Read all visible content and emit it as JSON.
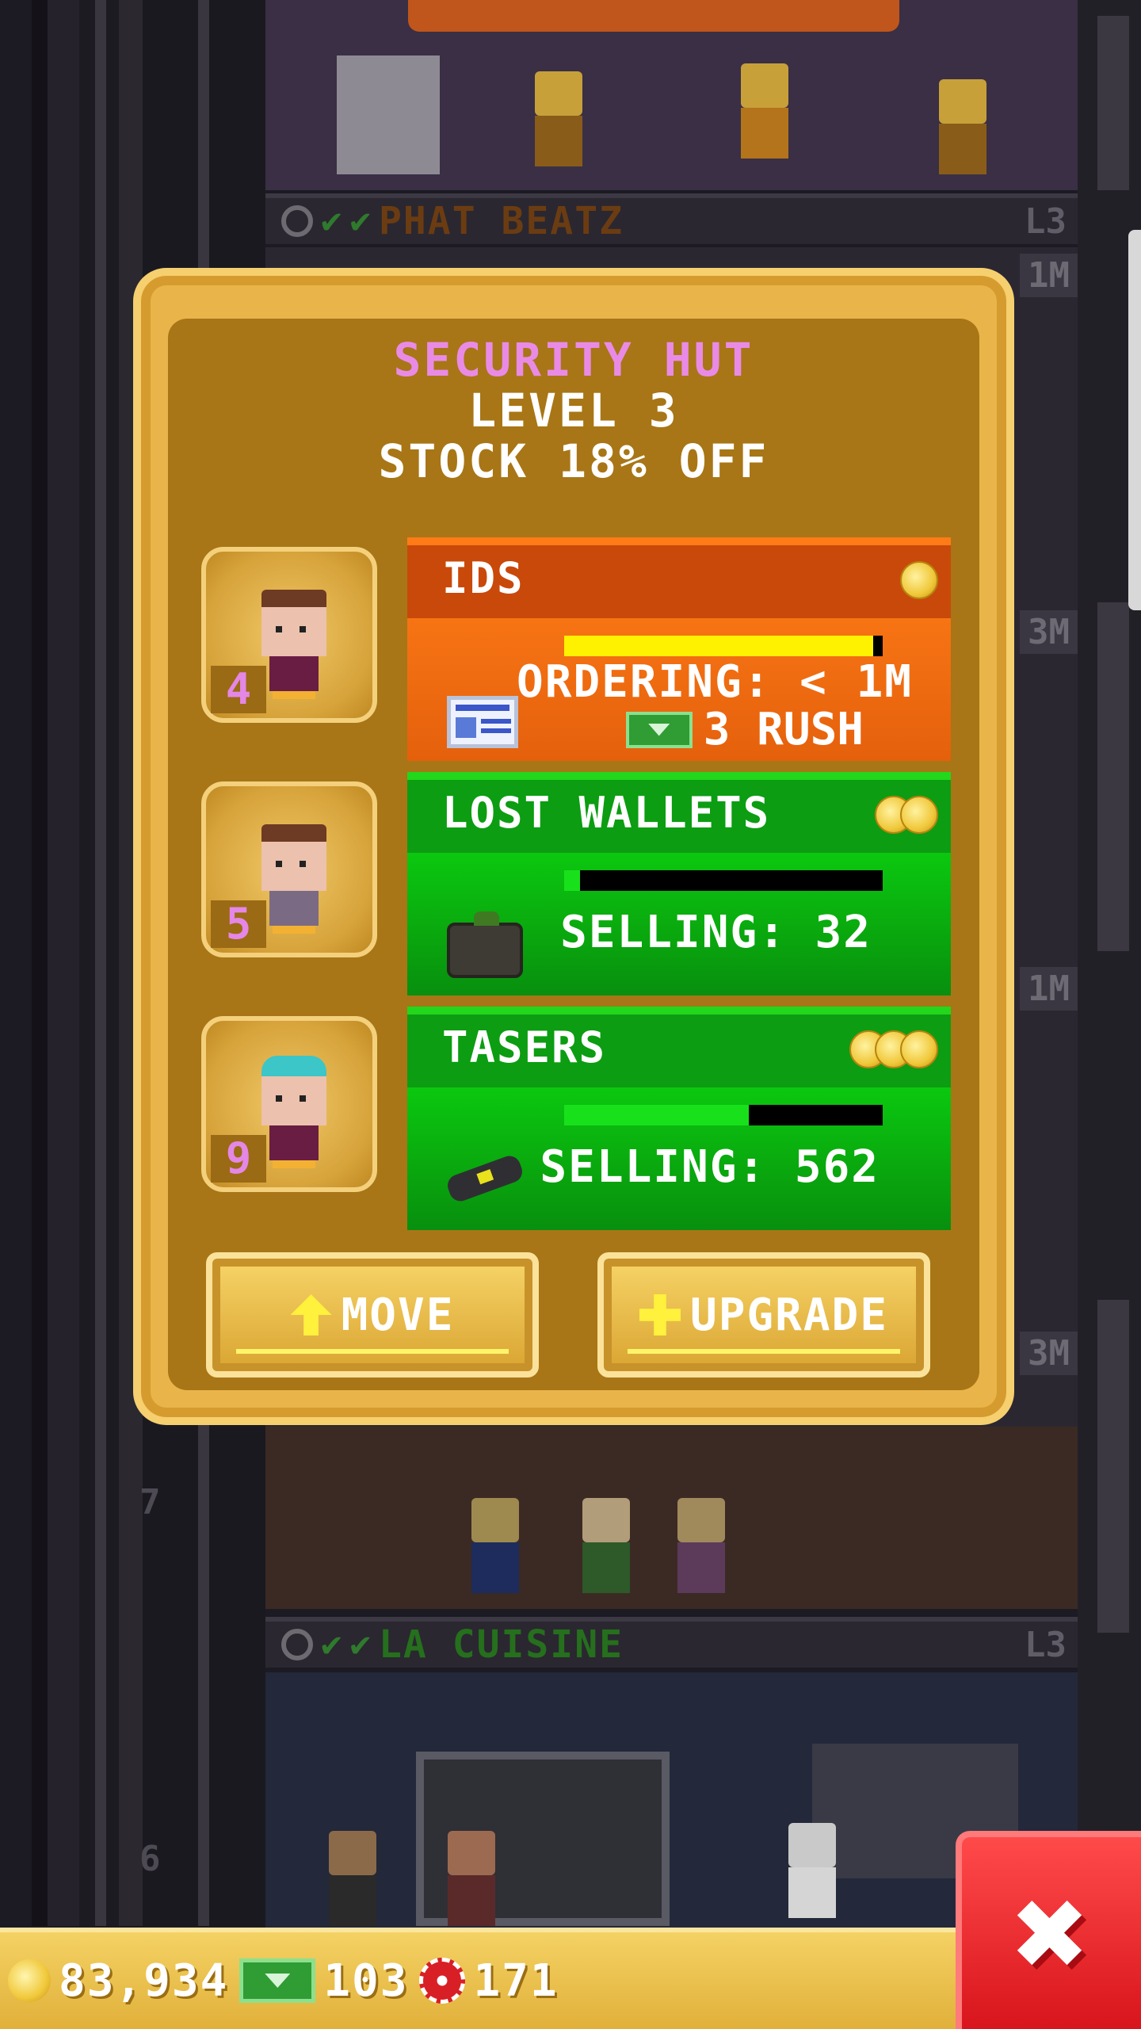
{
  "tower": {
    "floors": [
      {
        "name": "PHAT BEATZ",
        "level": "L3",
        "color": "#8c4d14"
      },
      {
        "name": "LA CUISINE",
        "level": "L3",
        "color": "#276b22"
      }
    ],
    "floor_numbers": [
      "7",
      "6"
    ],
    "side_tags": [
      "1M",
      "3M",
      "1M",
      "3M",
      "3M"
    ]
  },
  "dialog": {
    "title": "SECURITY HUT",
    "level": "LEVEL 3",
    "stock": "STOCK 18% OFF",
    "items": [
      {
        "name": "IDS",
        "worker_level": "4",
        "status": "ORDERING: < 1M",
        "rush": "3 RUSH",
        "coins": 1,
        "progress": 0.97,
        "theme": "orange",
        "bar_color": "#fff200",
        "icon": "id-card-icon"
      },
      {
        "name": "LOST WALLETS",
        "worker_level": "5",
        "status": "SELLING: 32",
        "coins": 2,
        "progress": 0.05,
        "theme": "green",
        "bar_color": "#18e11b",
        "icon": "wallet-icon"
      },
      {
        "name": "TASERS",
        "worker_level": "9",
        "status": "SELLING: 562",
        "coins": 3,
        "progress": 0.58,
        "theme": "green",
        "bar_color": "#18e11b",
        "icon": "taser-icon"
      }
    ],
    "move_label": "MOVE",
    "upgrade_label": "UPGRADE"
  },
  "hud": {
    "coins": "83,934",
    "bux": "103",
    "chips": "171"
  },
  "colors": {
    "title_pink": "#e98be6",
    "dialog_gold": "#e9b54a",
    "close_red": "#e8232a"
  }
}
